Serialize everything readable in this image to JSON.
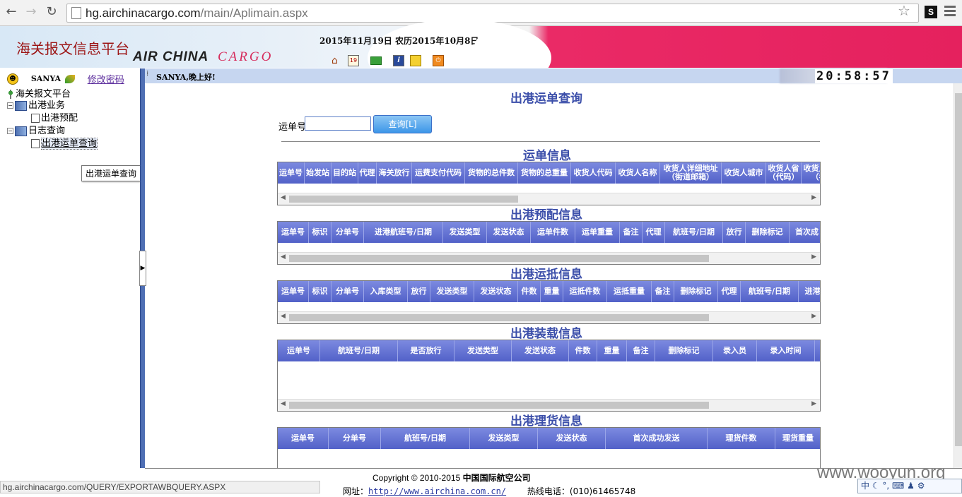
{
  "browser": {
    "url_host": "hg.airchinacargo.com",
    "url_path": "/main/Aplimain.aspx",
    "ext_badge": "S"
  },
  "header": {
    "site_title": "海关报文信息平台",
    "logo_text_1": "AIR CHINA",
    "logo_text_2": "CARGO",
    "date_text": "2015年11月19日  农历2015年10月8日",
    "tool_icons": [
      "home-icon",
      "calendar-icon",
      "mail-icon",
      "info-icon",
      "key-icon",
      "power-icon"
    ]
  },
  "sidebar": {
    "user": "SANYA",
    "change_password": "修改密码",
    "tree": {
      "root": "海关报文平台",
      "groups": [
        {
          "label": "出港业务",
          "children": [
            "出港预配"
          ]
        },
        {
          "label": "日志查询",
          "children": [
            "出港运单查询"
          ]
        }
      ]
    },
    "tooltip": "出港运单查询"
  },
  "topbar": {
    "greeting": "SANYA,晚上好!",
    "clock": "20:58:57"
  },
  "main": {
    "page_title": "出港运单查询",
    "awb_label": "运单号",
    "awb_value": "",
    "search_button": "查询[L]",
    "sections": [
      {
        "title": "运单信息",
        "columns": [
          "运单号",
          "始发站",
          "目的站",
          "代理",
          "海关放行",
          "运费支付代码",
          "货物的总件数",
          "货物的总重量",
          "收货人代码",
          "收货人名称",
          "收货人详细地址（街道邮箱）",
          "收货人城市",
          "收货人省（代码）",
          "收货人省（名"
        ]
      },
      {
        "title": "出港预配信息",
        "columns": [
          "运单号",
          "标识",
          "分单号",
          "进港航班号/日期",
          "发送类型",
          "发送状态",
          "运单件数",
          "运单重量",
          "备注",
          "代理",
          "航班号/日期",
          "放行",
          "删除标记",
          "首次成"
        ]
      },
      {
        "title": "出港运抵信息",
        "columns": [
          "运单号",
          "标识",
          "分单号",
          "入库类型",
          "放行",
          "发送类型",
          "发送状态",
          "件数",
          "重量",
          "运抵件数",
          "运抵重量",
          "备注",
          "删除标记",
          "代理",
          "航班号/日期",
          "进港"
        ]
      },
      {
        "title": "出港装载信息",
        "columns": [
          "运单号",
          "航班号/日期",
          "是否放行",
          "发送类型",
          "发送状态",
          "件数",
          "重量",
          "备注",
          "删除标记",
          "录入员",
          "录入时间",
          "首"
        ]
      },
      {
        "title": "出港理货信息",
        "columns": [
          "运单号",
          "分单号",
          "航班号/日期",
          "发送类型",
          "发送状态",
          "首次成功发送",
          "理货件数",
          "理货重量"
        ]
      }
    ]
  },
  "footer": {
    "copyright": "Copyright © 2010-2015 ",
    "company": "中国国际航空公司",
    "site_label": "网址：",
    "site_url": "http://www.airchina.com.cn/",
    "hotline": "热线电话：(010)61465748"
  },
  "statusbar": "hg.airchinacargo.com/QUERY/EXPORTAWBQUERY.ASPX",
  "watermark": "www.wooyun.org",
  "ime_text": "中"
}
